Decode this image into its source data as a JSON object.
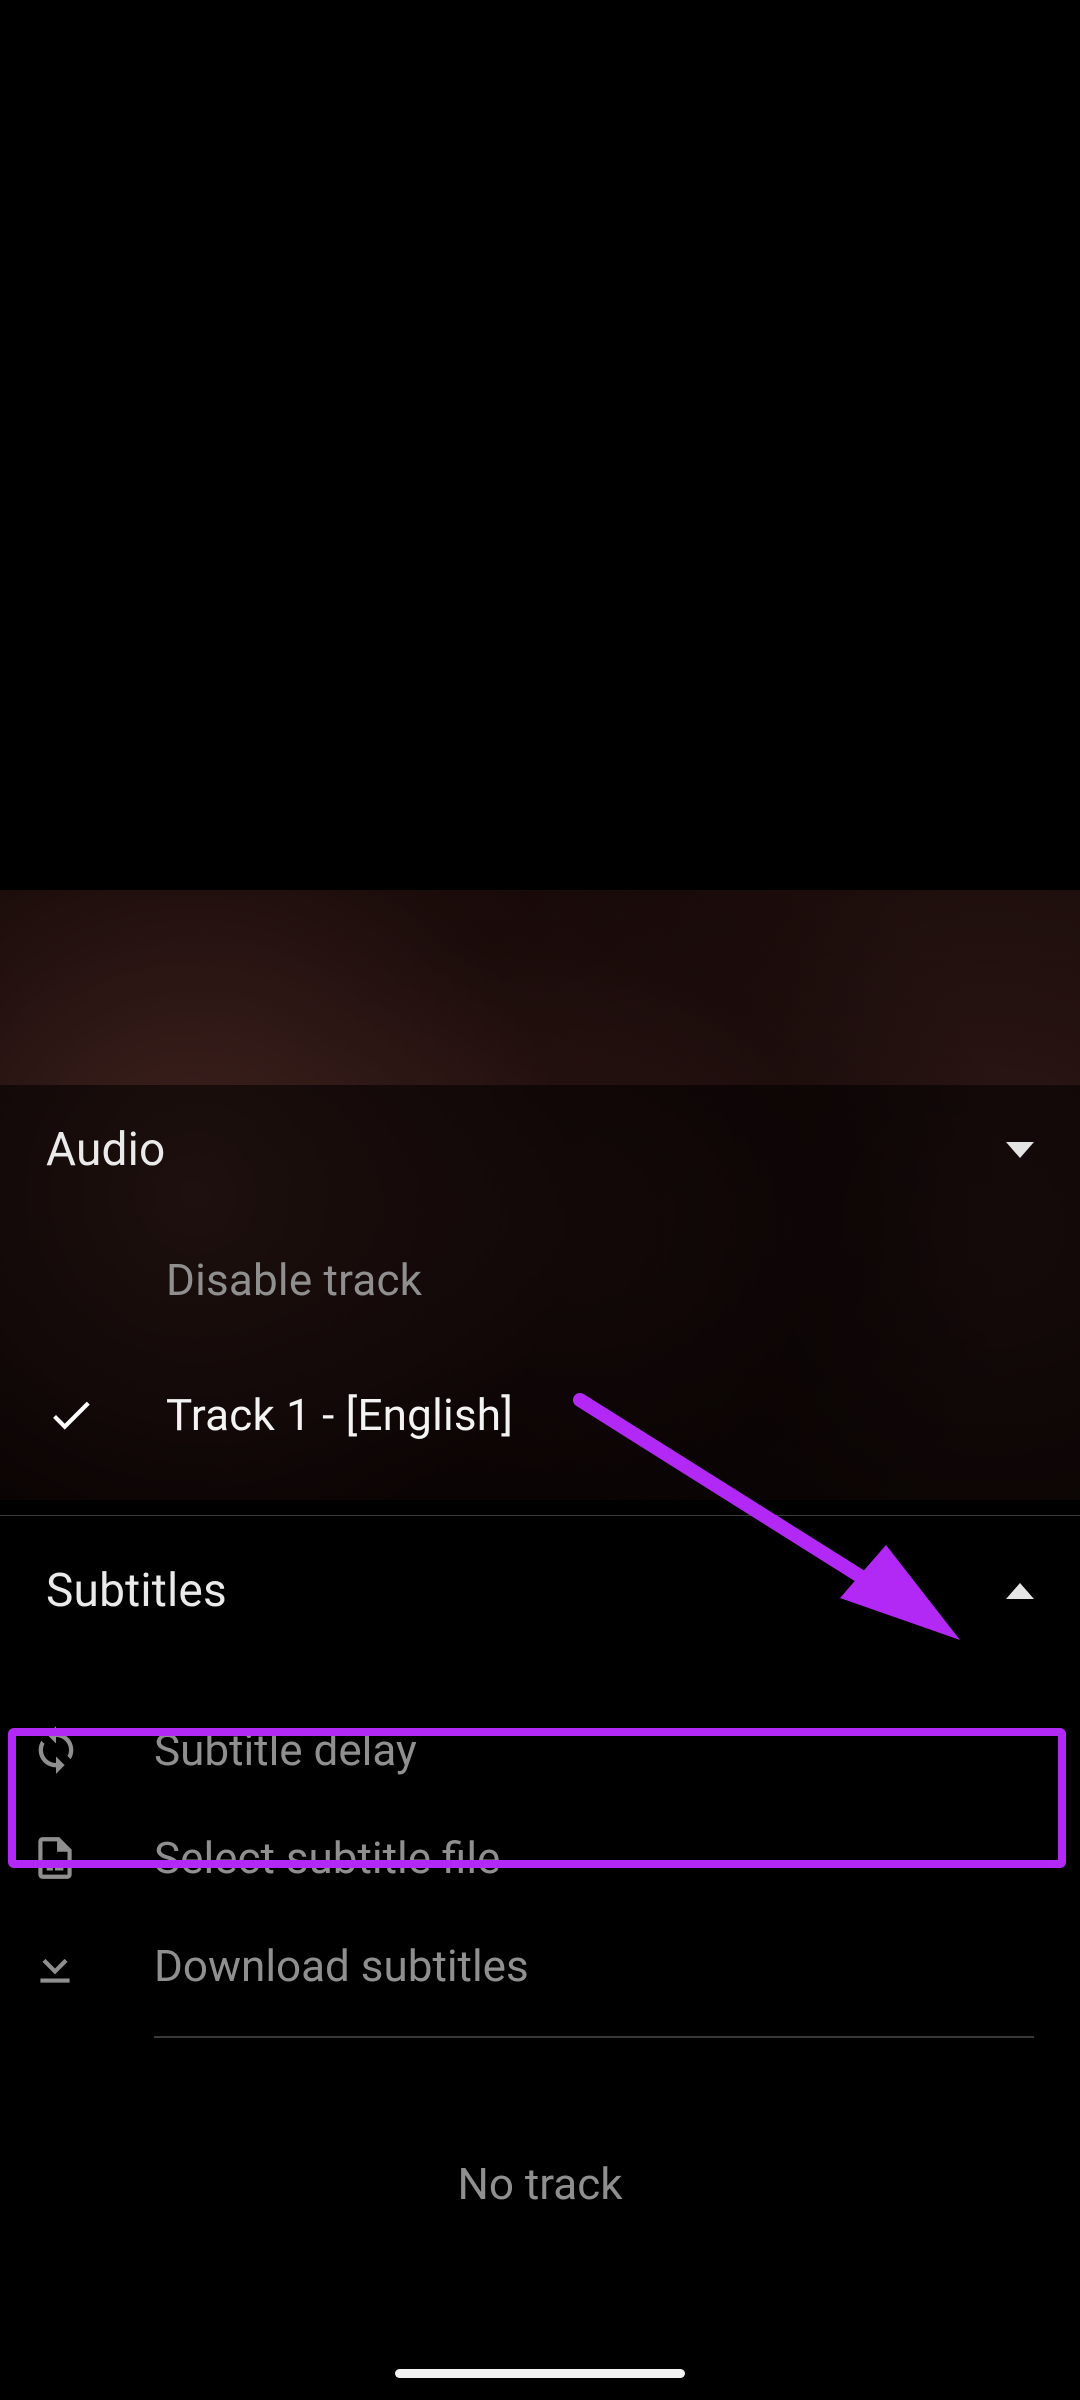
{
  "colors": {
    "highlight": "#b229f5"
  },
  "audio": {
    "title": "Audio",
    "disable_label": "Disable track",
    "selected_track_label": "Track 1 - [English]"
  },
  "subtitles": {
    "title": "Subtitles",
    "delay_label": "Subtitle delay",
    "select_file_label": "Select subtitle file",
    "download_label": "Download subtitles",
    "no_track_label": "No track"
  }
}
